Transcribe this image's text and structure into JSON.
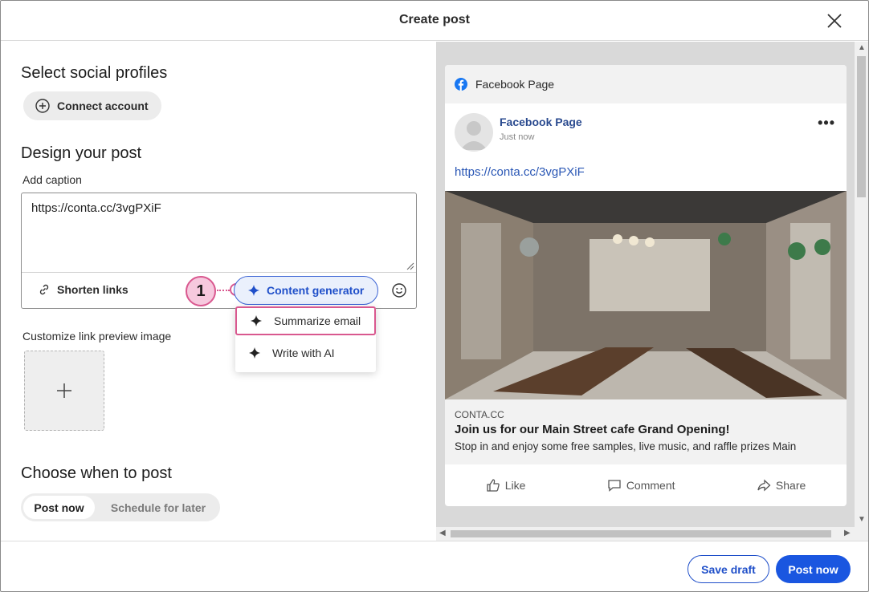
{
  "header": {
    "title": "Create post"
  },
  "profiles": {
    "title": "Select social profiles",
    "connect_label": "Connect account"
  },
  "design": {
    "title": "Design your post",
    "caption_label": "Add caption",
    "caption_value": "https://conta.cc/3vgPXiF",
    "shorten_label": "Shorten links",
    "content_generator_label": "Content generator",
    "menu": [
      {
        "label": "Summarize email"
      },
      {
        "label": "Write with AI"
      }
    ],
    "callout_number": "1",
    "preview_label": "Customize link preview image"
  },
  "schedule": {
    "title": "Choose when to post",
    "options": [
      "Post now",
      "Schedule for later"
    ],
    "selected": "Post now"
  },
  "preview": {
    "platform": "Facebook Page",
    "page_name": "Facebook Page",
    "time": "Just now",
    "link": "https://conta.cc/3vgPXiF",
    "domain": "CONTA.CC",
    "link_title": "Join us for our Main Street cafe Grand Opening!",
    "link_desc": "Stop in and enjoy some free samples, live music, and raffle prizes  Main",
    "actions": [
      "Like",
      "Comment",
      "Share"
    ]
  },
  "footer": {
    "save_draft": "Save draft",
    "post_now": "Post now"
  },
  "colors": {
    "accent": "#1a56e0",
    "callout": "#d9588f",
    "facebook_blue": "#1877f2"
  }
}
